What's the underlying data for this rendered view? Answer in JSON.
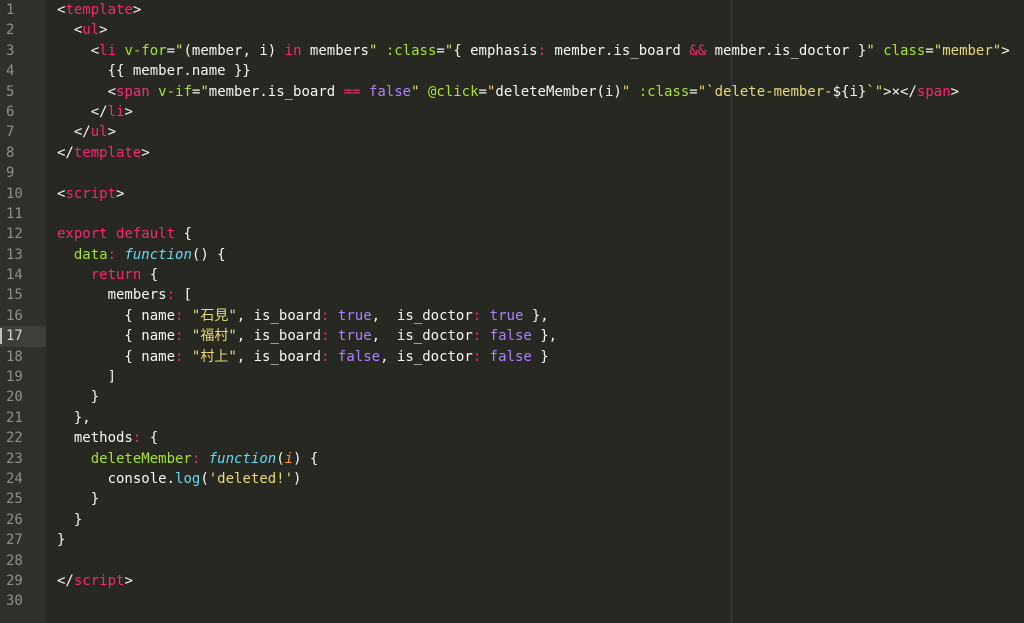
{
  "editor": {
    "current_line": 17,
    "colors": {
      "background": "#272822",
      "gutter": "#2f302a",
      "tag": "#f92672",
      "attribute": "#a6e22e",
      "string": "#e6db74",
      "keyword": "#f92672",
      "constant": "#ae81ff",
      "function_keyword": "#66d9ef",
      "parameter": "#fd971f"
    },
    "lines": [
      {
        "n": "1",
        "tokens": [
          [
            "punc",
            "<"
          ],
          [
            "tag",
            "template"
          ],
          [
            "punc",
            ">"
          ]
        ]
      },
      {
        "n": "2",
        "tokens": [
          [
            "plain",
            "  "
          ],
          [
            "punc",
            "<"
          ],
          [
            "tag",
            "ul"
          ],
          [
            "punc",
            ">"
          ]
        ]
      },
      {
        "n": "3",
        "tokens": [
          [
            "plain",
            "    "
          ],
          [
            "punc",
            "<"
          ],
          [
            "tag",
            "li"
          ],
          [
            "plain",
            " "
          ],
          [
            "attr",
            "v-for"
          ],
          [
            "punc",
            "="
          ],
          [
            "str",
            "\""
          ],
          [
            "plain",
            "(member, i) "
          ],
          [
            "kw",
            "in"
          ],
          [
            "plain",
            " members"
          ],
          [
            "str",
            "\""
          ],
          [
            "plain",
            " "
          ],
          [
            "attr",
            ":class"
          ],
          [
            "punc",
            "="
          ],
          [
            "str",
            "\""
          ],
          [
            "plain",
            "{ emphasis"
          ],
          [
            "kw",
            ":"
          ],
          [
            "plain",
            " member.is_board "
          ],
          [
            "kw",
            "&&"
          ],
          [
            "plain",
            " member.is_doctor }"
          ],
          [
            "str",
            "\""
          ],
          [
            "plain",
            " "
          ],
          [
            "attr",
            "class"
          ],
          [
            "punc",
            "="
          ],
          [
            "str",
            "\"member\""
          ],
          [
            "punc",
            ">"
          ]
        ]
      },
      {
        "n": "4",
        "tokens": [
          [
            "plain",
            "      {{ member.name }}"
          ]
        ]
      },
      {
        "n": "5",
        "tokens": [
          [
            "plain",
            "      "
          ],
          [
            "punc",
            "<"
          ],
          [
            "tag",
            "span"
          ],
          [
            "plain",
            " "
          ],
          [
            "attr",
            "v-if"
          ],
          [
            "punc",
            "="
          ],
          [
            "str",
            "\""
          ],
          [
            "plain",
            "member.is_board "
          ],
          [
            "kw",
            "=="
          ],
          [
            "plain",
            " "
          ],
          [
            "num",
            "false"
          ],
          [
            "str",
            "\""
          ],
          [
            "plain",
            " "
          ],
          [
            "attr",
            "@click"
          ],
          [
            "punc",
            "="
          ],
          [
            "str",
            "\""
          ],
          [
            "plain",
            "deleteMember(i)"
          ],
          [
            "str",
            "\""
          ],
          [
            "plain",
            " "
          ],
          [
            "attr",
            ":class"
          ],
          [
            "punc",
            "="
          ],
          [
            "str",
            "\"`delete-member-"
          ],
          [
            "plain",
            "${i}"
          ],
          [
            "str",
            "`\""
          ],
          [
            "punc",
            ">"
          ],
          [
            "plain",
            "×"
          ],
          [
            "punc",
            "</"
          ],
          [
            "tag",
            "span"
          ],
          [
            "punc",
            ">"
          ]
        ]
      },
      {
        "n": "6",
        "tokens": [
          [
            "plain",
            "    "
          ],
          [
            "punc",
            "</"
          ],
          [
            "tag",
            "li"
          ],
          [
            "punc",
            ">"
          ]
        ]
      },
      {
        "n": "7",
        "tokens": [
          [
            "plain",
            "  "
          ],
          [
            "punc",
            "</"
          ],
          [
            "tag",
            "ul"
          ],
          [
            "punc",
            ">"
          ]
        ]
      },
      {
        "n": "8",
        "tokens": [
          [
            "punc",
            "</"
          ],
          [
            "tag",
            "template"
          ],
          [
            "punc",
            ">"
          ]
        ]
      },
      {
        "n": "9",
        "tokens": []
      },
      {
        "n": "10",
        "tokens": [
          [
            "punc",
            "<"
          ],
          [
            "tag",
            "script"
          ],
          [
            "punc",
            ">"
          ]
        ]
      },
      {
        "n": "11",
        "tokens": []
      },
      {
        "n": "12",
        "tokens": [
          [
            "kw",
            "export"
          ],
          [
            "plain",
            " "
          ],
          [
            "kw",
            "default"
          ],
          [
            "plain",
            " {"
          ]
        ]
      },
      {
        "n": "13",
        "tokens": [
          [
            "plain",
            "  "
          ],
          [
            "name",
            "data"
          ],
          [
            "kw",
            ":"
          ],
          [
            "plain",
            " "
          ],
          [
            "fn",
            "function"
          ],
          [
            "plain",
            "() {"
          ]
        ]
      },
      {
        "n": "14",
        "tokens": [
          [
            "plain",
            "    "
          ],
          [
            "kw",
            "return"
          ],
          [
            "plain",
            " {"
          ]
        ]
      },
      {
        "n": "15",
        "tokens": [
          [
            "plain",
            "      members"
          ],
          [
            "kw",
            ":"
          ],
          [
            "plain",
            " ["
          ]
        ]
      },
      {
        "n": "16",
        "tokens": [
          [
            "plain",
            "        { name"
          ],
          [
            "kw",
            ":"
          ],
          [
            "plain",
            " "
          ],
          [
            "str",
            "\"石見\""
          ],
          [
            "plain",
            ", is_board"
          ],
          [
            "kw",
            ":"
          ],
          [
            "plain",
            " "
          ],
          [
            "num",
            "true"
          ],
          [
            "plain",
            ",  is_doctor"
          ],
          [
            "kw",
            ":"
          ],
          [
            "plain",
            " "
          ],
          [
            "num",
            "true"
          ],
          [
            "plain",
            " },"
          ]
        ]
      },
      {
        "n": "17",
        "tokens": [
          [
            "plain",
            "        { name"
          ],
          [
            "kw",
            ":"
          ],
          [
            "plain",
            " "
          ],
          [
            "str",
            "\"福村\""
          ],
          [
            "plain",
            ", is_board"
          ],
          [
            "kw",
            ":"
          ],
          [
            "plain",
            " "
          ],
          [
            "num",
            "true"
          ],
          [
            "plain",
            ",  is_doctor"
          ],
          [
            "kw",
            ":"
          ],
          [
            "plain",
            " "
          ],
          [
            "num",
            "false"
          ],
          [
            "plain",
            " },"
          ]
        ]
      },
      {
        "n": "18",
        "tokens": [
          [
            "plain",
            "        { name"
          ],
          [
            "kw",
            ":"
          ],
          [
            "plain",
            " "
          ],
          [
            "str",
            "\"村上\""
          ],
          [
            "plain",
            ", is_board"
          ],
          [
            "kw",
            ":"
          ],
          [
            "plain",
            " "
          ],
          [
            "num",
            "false"
          ],
          [
            "plain",
            ", is_doctor"
          ],
          [
            "kw",
            ":"
          ],
          [
            "plain",
            " "
          ],
          [
            "num",
            "false"
          ],
          [
            "plain",
            " }"
          ]
        ]
      },
      {
        "n": "19",
        "tokens": [
          [
            "plain",
            "      ]"
          ]
        ]
      },
      {
        "n": "20",
        "tokens": [
          [
            "plain",
            "    }"
          ]
        ]
      },
      {
        "n": "21",
        "tokens": [
          [
            "plain",
            "  },"
          ]
        ]
      },
      {
        "n": "22",
        "tokens": [
          [
            "plain",
            "  methods"
          ],
          [
            "kw",
            ":"
          ],
          [
            "plain",
            " {"
          ]
        ]
      },
      {
        "n": "23",
        "tokens": [
          [
            "plain",
            "    "
          ],
          [
            "name",
            "deleteMember"
          ],
          [
            "kw",
            ":"
          ],
          [
            "plain",
            " "
          ],
          [
            "fn",
            "function"
          ],
          [
            "plain",
            "("
          ],
          [
            "param",
            "i"
          ],
          [
            "plain",
            ") {"
          ]
        ]
      },
      {
        "n": "24",
        "tokens": [
          [
            "plain",
            "      console."
          ],
          [
            "method",
            "log"
          ],
          [
            "plain",
            "("
          ],
          [
            "str",
            "'deleted!'"
          ],
          [
            "plain",
            ")"
          ]
        ]
      },
      {
        "n": "25",
        "tokens": [
          [
            "plain",
            "    }"
          ]
        ]
      },
      {
        "n": "26",
        "tokens": [
          [
            "plain",
            "  }"
          ]
        ]
      },
      {
        "n": "27",
        "tokens": [
          [
            "plain",
            "}"
          ]
        ]
      },
      {
        "n": "28",
        "tokens": []
      },
      {
        "n": "29",
        "tokens": [
          [
            "punc",
            "</"
          ],
          [
            "tag",
            "script"
          ],
          [
            "punc",
            ">"
          ]
        ]
      },
      {
        "n": "30",
        "tokens": []
      }
    ]
  }
}
